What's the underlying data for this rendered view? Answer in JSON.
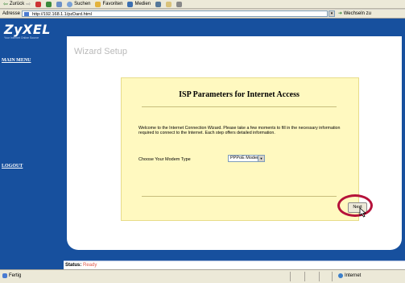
{
  "toolbar": {
    "back_label": "Zurück",
    "search_label": "Suchen",
    "favorites_label": "Favoriten",
    "media_label": "Medien"
  },
  "address": {
    "label": "Adresse",
    "url": "http://192.168.1.1/pzDard.html",
    "go_label": "Wechseln zu"
  },
  "sidebar": {
    "logo": "ZyXEL",
    "logo_sub": "Your Internet Online Source",
    "main_menu": "MAIN MENU",
    "logout": "LOGOUT"
  },
  "main": {
    "wizard_title": "Wizard Setup",
    "panel_title": "ISP Parameters for Internet Access",
    "welcome_text": "Welcome to the Internet Connection Wizard. Please take a few moments to fill in the necessary information required to connect to the Internet. Each step offers detailed information.",
    "modem_label": "Choose Your Modem Type",
    "modem_value": "PPPoE Modem",
    "next_label": "Next"
  },
  "status": {
    "label": "Status:",
    "value": "Ready"
  },
  "ie_status": {
    "left": "Fertig",
    "zone": "Internet"
  },
  "colors": {
    "brand_blue": "#17509e",
    "panel_yellow": "#fff9c0",
    "highlight_ring": "#b5123a",
    "status_value": "#e0584a"
  }
}
